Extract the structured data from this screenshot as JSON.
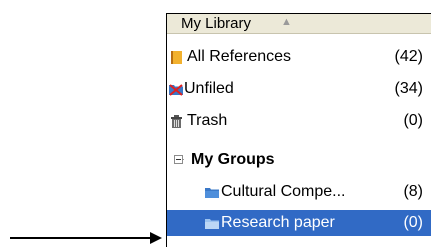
{
  "library": {
    "header": "My Library",
    "items": [
      {
        "label": "All References",
        "count": "(42)",
        "icon": "book-icon"
      },
      {
        "label": "Unfiled",
        "count": "(34)",
        "icon": "unfiled-folder-icon"
      },
      {
        "label": "Trash",
        "count": "(0)",
        "icon": "trash-icon"
      }
    ]
  },
  "groups": {
    "header": "My Groups",
    "items": [
      {
        "label": "Cultural Compe...",
        "count": "(8)",
        "icon": "folder-icon"
      },
      {
        "label": "Research paper",
        "count": "(0)",
        "icon": "folder-icon"
      }
    ]
  },
  "colors": {
    "selection": "#316ac5",
    "header_bg": "#ece9d8",
    "folder": "#3a78c7",
    "book": "#f2b12e"
  }
}
